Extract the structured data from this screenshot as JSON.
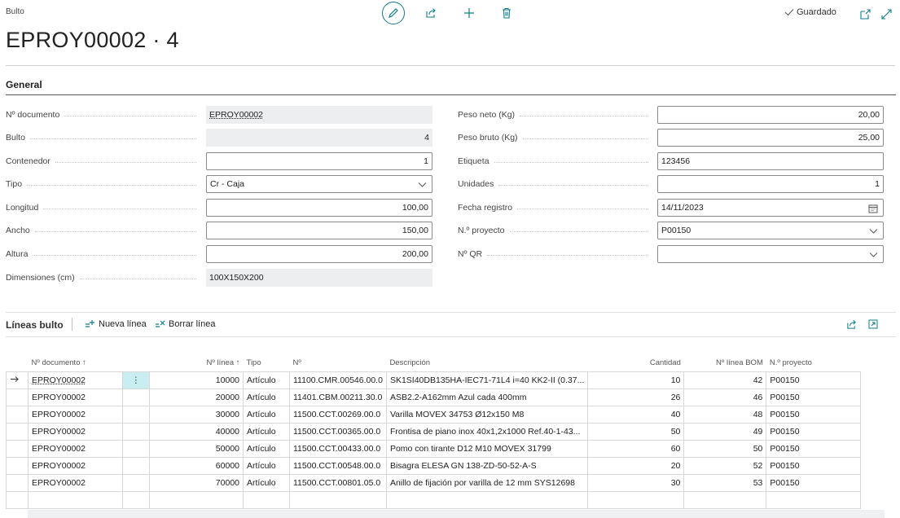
{
  "header": {
    "breadcrumb": "Bulto",
    "title": "EPROY00002 · 4",
    "status": "Guardado"
  },
  "general": {
    "title": "General",
    "left": [
      {
        "label": "Nº documento",
        "value": "EPROY00002",
        "kind": "readonly-link"
      },
      {
        "label": "Bulto",
        "value": "4",
        "kind": "readonly-right"
      },
      {
        "label": "Contenedor",
        "value": "1",
        "kind": "edit-right"
      },
      {
        "label": "Tipo",
        "value": "Cr - Caja",
        "kind": "select"
      },
      {
        "label": "Longitud",
        "value": "100,00",
        "kind": "edit-right"
      },
      {
        "label": "Ancho",
        "value": "150,00",
        "kind": "edit-right"
      },
      {
        "label": "Altura",
        "value": "200,00",
        "kind": "edit-right"
      },
      {
        "label": "Dimensiones (cm)",
        "value": "100X150X200",
        "kind": "readonly"
      }
    ],
    "right": [
      {
        "label": "Peso neto (Kg)",
        "value": "20,00",
        "kind": "edit-right"
      },
      {
        "label": "Peso bruto (Kg)",
        "value": "25,00",
        "kind": "edit-right"
      },
      {
        "label": "Etiqueta",
        "value": "123456",
        "kind": "edit"
      },
      {
        "label": "Unidades",
        "value": "1",
        "kind": "edit-right"
      },
      {
        "label": "Fecha registro",
        "value": "14/11/2023",
        "kind": "date"
      },
      {
        "label": "N.º proyecto",
        "value": "P00150",
        "kind": "select"
      },
      {
        "label": "Nº QR",
        "value": "",
        "kind": "select"
      }
    ]
  },
  "lines": {
    "title": "Líneas bulto",
    "new_line": "Nueva línea",
    "delete_line": "Borrar línea",
    "columns": [
      "Nº documento ↑",
      "Nº línea ↑",
      "Tipo",
      "Nº",
      "Descripción",
      "Cantidad",
      "Nº línea BOM",
      "N.º proyecto"
    ],
    "rows": [
      [
        "EPROY00002",
        "10000",
        "Artículo",
        "11100.CMR.00546.00.0",
        "SK1SI40DB135HA-IEC71-71L4 i=40 KK2-II (0.37...",
        "10",
        "42",
        "P00150"
      ],
      [
        "EPROY00002",
        "20000",
        "Artículo",
        "11401.CBM.00211.30.0",
        "ASB2.2-A162mm Azul cada 400mm",
        "26",
        "46",
        "P00150"
      ],
      [
        "EPROY00002",
        "30000",
        "Artículo",
        "11500.CCT.00269.00.0",
        "Varilla MOVEX 34753 Ø12x150 M8",
        "40",
        "48",
        "P00150"
      ],
      [
        "EPROY00002",
        "40000",
        "Artículo",
        "11500.CCT.00365.00.0",
        "Frontisa de piano inox 40x1,2x1000 Ref.40-1-43...",
        "50",
        "49",
        "P00150"
      ],
      [
        "EPROY00002",
        "50000",
        "Artículo",
        "11500.CCT.00433.00.0",
        "Pomo con tirante D12 M10 MOVEX 31799",
        "60",
        "50",
        "P00150"
      ],
      [
        "EPROY00002",
        "60000",
        "Artículo",
        "11500.CCT.00548.00.0",
        "Bisagra ELESA GN 138-ZD-50-52-A-S",
        "20",
        "52",
        "P00150"
      ],
      [
        "EPROY00002",
        "70000",
        "Artículo",
        "11500.CCT.00801.05.0",
        "Anillo de fijación por varilla de 12 mm SYS12698",
        "30",
        "53",
        "P00150"
      ]
    ]
  },
  "colors": {
    "accent": "#0f7b8a",
    "selected_cell": "#c9eef2",
    "readonly_bg": "#edeef0"
  },
  "icons": [
    "edit-icon",
    "share-icon",
    "add-icon",
    "delete-icon",
    "check-icon",
    "open-new-window-icon",
    "expand-icon",
    "new-line-icon",
    "delete-line-icon",
    "calendar-icon",
    "chevron-down-icon",
    "row-arrow-icon",
    "row-menu-icon"
  ]
}
